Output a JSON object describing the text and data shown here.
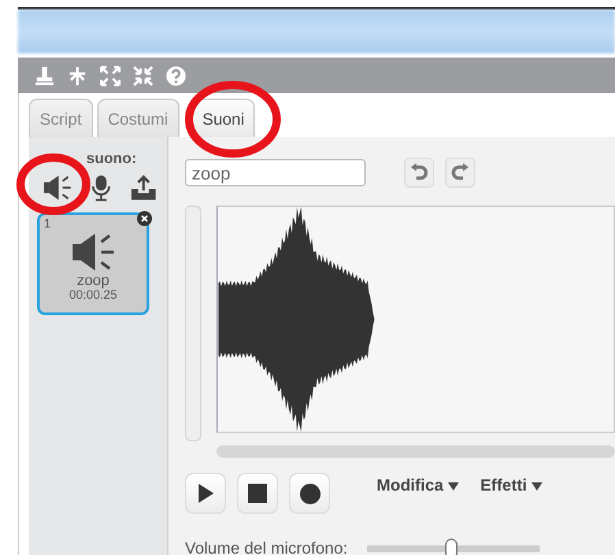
{
  "tabs": [
    {
      "label": "Script",
      "selected": false
    },
    {
      "label": "Costumi",
      "selected": false
    },
    {
      "label": "Suoni",
      "selected": true
    }
  ],
  "new_sound": {
    "label": "suono:"
  },
  "sounds": [
    {
      "number": "1",
      "name": "zoop",
      "duration": "00:00.25",
      "selected": true
    }
  ],
  "editor": {
    "sound_name": "zoop",
    "menus": [
      "Modifica",
      "Effetti"
    ],
    "microphone": {
      "label": "Volume del microfono:",
      "level": 0.49
    }
  }
}
